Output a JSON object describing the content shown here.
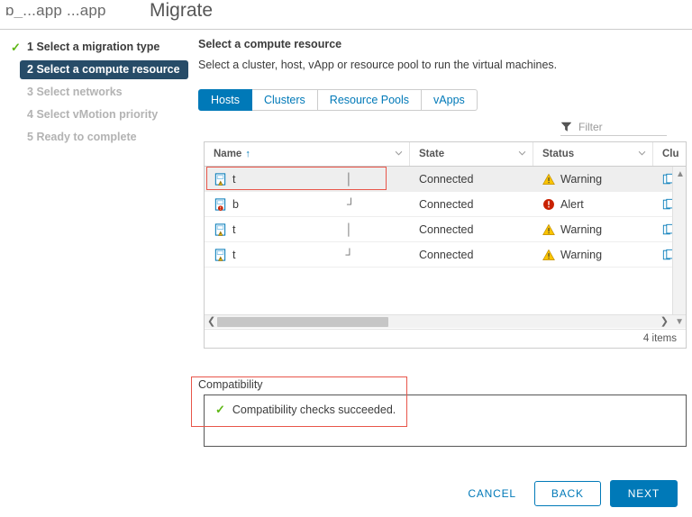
{
  "window": {
    "vm_name": "b_...app  ...app",
    "wizard_title": "Migrate"
  },
  "steps": [
    {
      "num": "1",
      "label": "Select a migration type",
      "state": "done"
    },
    {
      "num": "2",
      "label": "Select a compute resource",
      "state": "current"
    },
    {
      "num": "3",
      "label": "Select networks",
      "state": "pending"
    },
    {
      "num": "4",
      "label": "Select vMotion priority",
      "state": "pending"
    },
    {
      "num": "5",
      "label": "Ready to complete",
      "state": "pending"
    }
  ],
  "page": {
    "heading": "Select a compute resource",
    "subheading": "Select a cluster, host, vApp or resource pool to run the virtual machines."
  },
  "tabs": [
    {
      "label": "Hosts",
      "active": true
    },
    {
      "label": "Clusters",
      "active": false
    },
    {
      "label": "Resource Pools",
      "active": false
    },
    {
      "label": "vApps",
      "active": false
    }
  ],
  "filter": {
    "placeholder": "Filter",
    "value": "",
    "icon": "funnel-icon"
  },
  "grid": {
    "columns": [
      {
        "key": "name",
        "label": "Name",
        "sorted": "asc",
        "sort_glyph": "↑"
      },
      {
        "key": "state",
        "label": "State",
        "sorted": ""
      },
      {
        "key": "status",
        "label": "Status",
        "sorted": ""
      },
      {
        "key": "cluster",
        "label": "Clu",
        "sorted": ""
      }
    ],
    "rows": [
      {
        "name": "t",
        "name_tail": "│",
        "state": "Connected",
        "status": "Warning",
        "status_kind": "warning",
        "host_badge": "warning",
        "selected": true
      },
      {
        "name": "b",
        "name_tail": "┘",
        "state": "Connected",
        "status": "Alert",
        "status_kind": "alert",
        "host_badge": "alert",
        "selected": false
      },
      {
        "name": "t",
        "name_tail": "│",
        "state": "Connected",
        "status": "Warning",
        "status_kind": "warning",
        "host_badge": "warning",
        "selected": false
      },
      {
        "name": "t",
        "name_tail": "┘",
        "state": "Connected",
        "status": "Warning",
        "status_kind": "warning",
        "host_badge": "warning",
        "selected": false
      }
    ],
    "items_count": "4 items"
  },
  "compatibility": {
    "label": "Compatibility",
    "message": "Compatibility checks succeeded."
  },
  "footer": {
    "cancel": "CANCEL",
    "back": "BACK",
    "next": "NEXT"
  },
  "colors": {
    "accent_blue": "#0079b8",
    "step_current_bg": "#274c68",
    "success_green": "#5eb715",
    "warning_yellow": "#fac400",
    "alert_red": "#c92100",
    "annotation_red": "#e8564a"
  }
}
